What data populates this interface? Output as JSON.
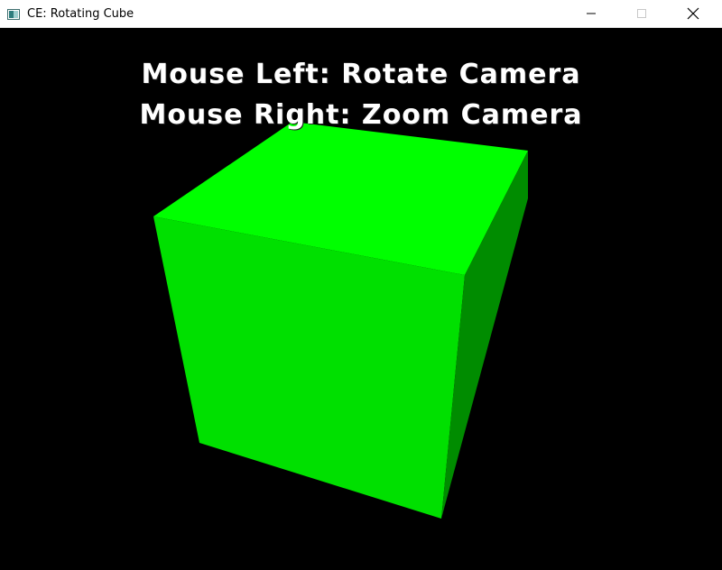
{
  "window": {
    "title": "CE: Rotating Cube",
    "controls": {
      "minimize_icon": "minimize-icon",
      "maximize_icon": "maximize-icon",
      "close_icon": "close-icon"
    }
  },
  "hud": {
    "line1": "Mouse Left: Rotate Camera",
    "line2": "Mouse Right: Zoom Camera"
  },
  "scene": {
    "background": "#000000",
    "cube_colors": {
      "top": "#00ff00",
      "front": "#00e000",
      "side": "#008c00"
    }
  }
}
